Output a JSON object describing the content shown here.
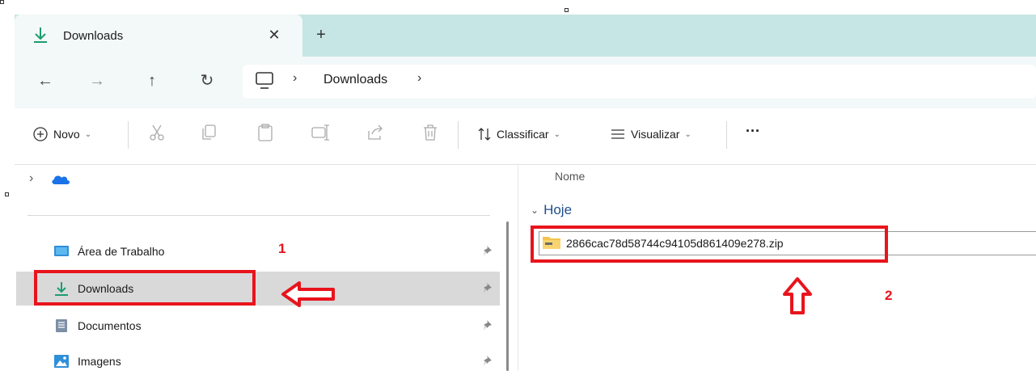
{
  "tab": {
    "label": "Downloads",
    "close": "✕",
    "new": "+"
  },
  "nav": {
    "back": "←",
    "forward": "→",
    "up": "↑",
    "refresh": "↻"
  },
  "address": {
    "separator": "›",
    "location": "Downloads"
  },
  "toolbar": {
    "new_label": "Novo",
    "sort_label": "Classificar",
    "view_label": "Visualizar",
    "more": "···",
    "chevron": "⌄"
  },
  "sidebar": {
    "expand": "›",
    "items": [
      {
        "label": "Área de Trabalho",
        "icon": "desktop-icon"
      },
      {
        "label": "Downloads",
        "icon": "download-icon",
        "selected": true
      },
      {
        "label": "Documentos",
        "icon": "document-icon"
      },
      {
        "label": "Imagens",
        "icon": "pictures-icon"
      }
    ]
  },
  "main": {
    "column_name": "Nome",
    "group_chevron": "⌄",
    "group_label": "Hoje",
    "file_name": "2866cac78d58744c94105d861409e278.zip"
  },
  "annotations": {
    "one": "1",
    "two": "2"
  },
  "colors": {
    "accent_red": "#e8141c",
    "titlebar": "#c5e6e4",
    "download_green": "#1c9c6e",
    "onedrive_blue": "#1a73e8"
  }
}
